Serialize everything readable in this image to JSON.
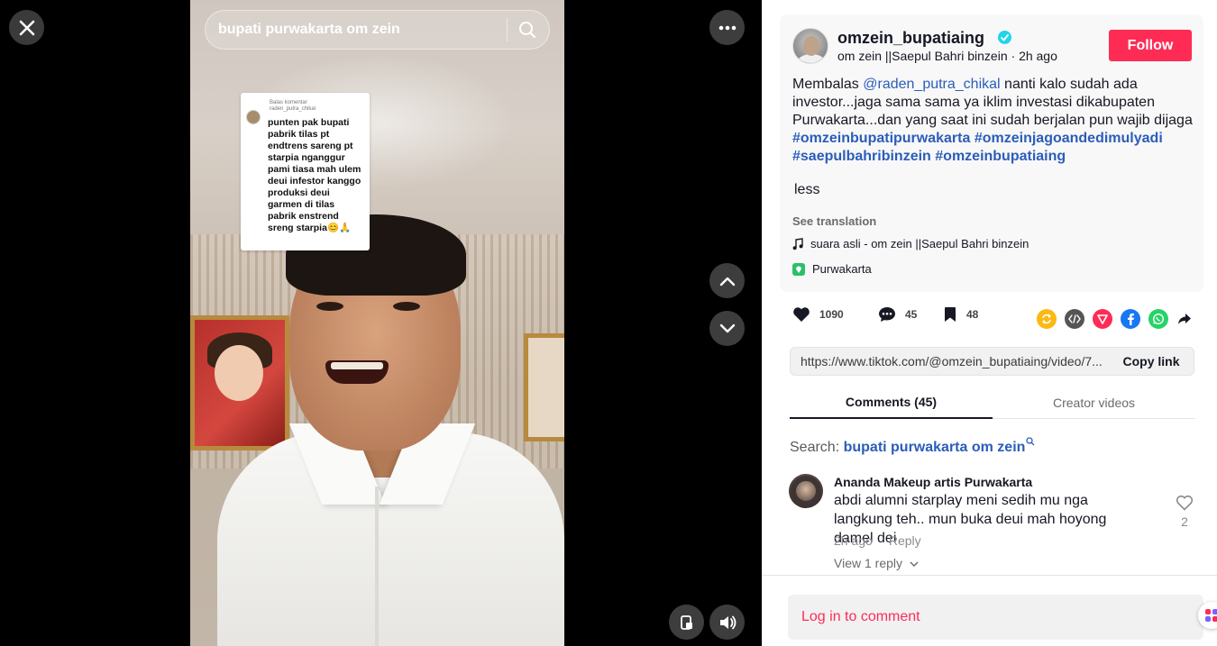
{
  "video": {
    "search_query": "bupati purwakarta om zein",
    "comment_card": {
      "reply_label": "Balas komentar",
      "reply_user": "raden_putra_chikal",
      "text": "punten pak bupati pabrik tilas pt endtrens sareng pt starpia nganggur pami tiasa mah ulem deui infestor kanggo produksi deui garmen di tilas pabrik enstrend sreng starpia😊🙏"
    }
  },
  "author": {
    "username": "omzein_bupatiaing",
    "nickname": "om zein ||Saepul Bahri binzein",
    "time": "2h ago",
    "follow_label": "Follow"
  },
  "description": {
    "prefix": "Membalas ",
    "mention": "@raden_putra_chikal",
    "body": " nanti kalo sudah ada investor...jaga sama sama ya iklim investasi dikabupaten Purwakarta...dan yang saat ini sudah berjalan pun wajib dijaga ",
    "hashtags": [
      "#omzeinbupatipurwakarta",
      "#omzeinjagoandedimulyadi",
      "#saepulbahribinzein",
      "#omzeinbupatiaing"
    ],
    "less_label": "less",
    "see_translation": "See translation",
    "music": "suara asli - om zein ||Saepul Bahri binzein",
    "location": "Purwakarta"
  },
  "stats": {
    "likes": "1090",
    "comments": "45",
    "saves": "48"
  },
  "link": {
    "url": "https://www.tiktok.com/@omzein_bupatiaing/video/7...",
    "copy_label": "Copy link"
  },
  "tabs": {
    "comments": "Comments (45)",
    "creator": "Creator videos"
  },
  "search_line": {
    "label": "Search: ",
    "query": "bupati purwakarta om zein"
  },
  "comment": {
    "name": "Ananda Makeup artis Purwakarta",
    "text": "abdi alumni starplay meni sedih mu nga langkung teh.. mun buka deui mah hoyong damel dei",
    "time": "2h ago",
    "reply_label": "Reply",
    "view_replies": "View 1 reply",
    "likes": "2"
  },
  "login": {
    "label": "Log in to comment"
  },
  "colors": {
    "accent": "#fe2c55",
    "link": "#2b5db9",
    "verified": "#20d5ec"
  }
}
